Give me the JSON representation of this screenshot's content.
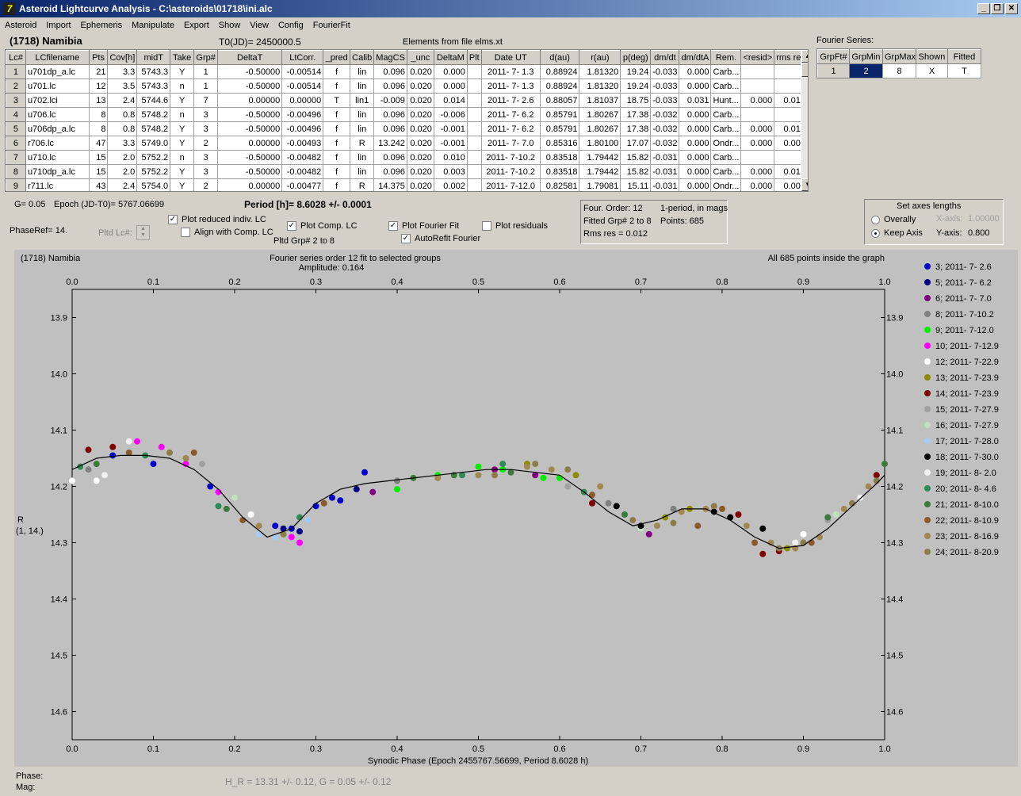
{
  "window": {
    "title": "Asteroid Lightcurve Analysis - C:\\asteroids\\01718\\ini.alc",
    "icon": "app-icon"
  },
  "menu": [
    "Asteroid",
    "Import",
    "Ephemeris",
    "Manipulate",
    "Export",
    "Show",
    "View",
    "Config",
    "FourierFit"
  ],
  "header": {
    "object": "(1718) Namibia",
    "t0": "T0(JD)= 2450000.5",
    "elements": "Elements from file elms.xt",
    "fourier_label": "Fourier Series:"
  },
  "lc_table": {
    "columns": [
      "Lc#",
      "LCfilename",
      "Pts",
      "Cov[h]",
      "midT",
      "Take",
      "Grp#",
      "DeltaT",
      "LtCorr.",
      "_pred",
      "Calib",
      "MagCS",
      "_unc",
      "DeltaM",
      "Plt",
      "Date UT",
      "d(au)",
      "r(au)",
      "p(deg)",
      "dm/dt",
      "dm/dtA",
      "Rem.",
      "<resid>",
      "rms res"
    ],
    "rows": [
      [
        "1",
        "u701dp_a.lc",
        "21",
        "3.3",
        "5743.3",
        "Y",
        "1",
        "-0.50000",
        "-0.00514",
        "f",
        "lin",
        "0.096",
        "0.020",
        "0.000",
        "",
        "2011- 7- 1.3",
        "0.88924",
        "1.81320",
        "19.24",
        "-0.033",
        "0.000",
        "Carb...",
        "",
        ""
      ],
      [
        "2",
        "u701.lc",
        "12",
        "3.5",
        "5743.3",
        "n",
        "1",
        "-0.50000",
        "-0.00514",
        "f",
        "lin",
        "0.096",
        "0.020",
        "0.000",
        "",
        "2011- 7- 1.3",
        "0.88924",
        "1.81320",
        "19.24",
        "-0.033",
        "0.000",
        "Carb...",
        "",
        ""
      ],
      [
        "3",
        "u702.lci",
        "13",
        "2.4",
        "5744.6",
        "Y",
        "7",
        "0.00000",
        "0.00000",
        "T",
        "lin1",
        "-0.009",
        "0.020",
        "0.014",
        "",
        "2011- 7- 2.6",
        "0.88057",
        "1.81037",
        "18.75",
        "-0.033",
        "0.031",
        "Hunt...",
        "0.000",
        "0.010"
      ],
      [
        "4",
        "u706.lc",
        "8",
        "0.8",
        "5748.2",
        "n",
        "3",
        "-0.50000",
        "-0.00496",
        "f",
        "lin",
        "0.096",
        "0.020",
        "-0.006",
        "",
        "2011- 7- 6.2",
        "0.85791",
        "1.80267",
        "17.38",
        "-0.032",
        "0.000",
        "Carb...",
        "",
        ""
      ],
      [
        "5",
        "u706dp_a.lc",
        "8",
        "0.8",
        "5748.2",
        "Y",
        "3",
        "-0.50000",
        "-0.00496",
        "f",
        "lin",
        "0.096",
        "0.020",
        "-0.001",
        "",
        "2011- 7- 6.2",
        "0.85791",
        "1.80267",
        "17.38",
        "-0.032",
        "0.000",
        "Carb...",
        "0.000",
        "0.018"
      ],
      [
        "6",
        "r706.lc",
        "47",
        "3.3",
        "5749.0",
        "Y",
        "2",
        "0.00000",
        "-0.00493",
        "f",
        "R",
        "13.242",
        "0.020",
        "-0.001",
        "",
        "2011- 7- 7.0",
        "0.85316",
        "1.80100",
        "17.07",
        "-0.032",
        "0.000",
        "Ondr...",
        "0.000",
        "0.006"
      ],
      [
        "7",
        "u710.lc",
        "15",
        "2.0",
        "5752.2",
        "n",
        "3",
        "-0.50000",
        "-0.00482",
        "f",
        "lin",
        "0.096",
        "0.020",
        "0.010",
        "",
        "2011- 7-10.2",
        "0.83518",
        "1.79442",
        "15.82",
        "-0.031",
        "0.000",
        "Carb...",
        "",
        ""
      ],
      [
        "8",
        "u710dp_a.lc",
        "15",
        "2.0",
        "5752.2",
        "Y",
        "3",
        "-0.50000",
        "-0.00482",
        "f",
        "lin",
        "0.096",
        "0.020",
        "0.003",
        "",
        "2011- 7-10.2",
        "0.83518",
        "1.79442",
        "15.82",
        "-0.031",
        "0.000",
        "Carb...",
        "0.000",
        "0.014"
      ],
      [
        "9",
        "r711.lc",
        "43",
        "2.4",
        "5754.0",
        "Y",
        "2",
        "0.00000",
        "-0.00477",
        "f",
        "R",
        "14.375",
        "0.020",
        "0.002",
        "",
        "2011- 7-12.0",
        "0.82581",
        "1.79081",
        "15.11",
        "-0.031",
        "0.000",
        "Ondr...",
        "0.000",
        "0.008"
      ]
    ]
  },
  "fourier_table": {
    "columns": [
      "GrpFt#",
      "GrpMin",
      "GrpMax",
      "Shown",
      "Fitted"
    ],
    "row": [
      "1",
      "2",
      "8",
      "X",
      "T"
    ]
  },
  "controls": {
    "g_value": "G= 0.05",
    "epoch": "Epoch (JD-T0)= 5767.06699",
    "period": "Period [h]= 8.6028 +/- 0.0001",
    "phaseref": "PhaseRef= 14.",
    "pltd_lc": "Pltd Lc#:",
    "plot_reduced": "Plot reduced indiv. LC",
    "align_comp": "Align with Comp. LC",
    "plot_comp": "Plot Comp. LC",
    "pltd_grp": "Pltd Grp#  2   to   8",
    "plot_fourier": "Plot Fourier Fit",
    "autorefit": "AutoRefit Fourier",
    "plot_resid": "Plot residuals",
    "four_order": "Four. Order: 12",
    "one_period": "1-period, in mags",
    "fitted_grp": "Fitted Grp# 2 to 8",
    "points": "Points: 685",
    "rms_res": "Rms res     = 0.012",
    "axes_title": "Set axes lengths",
    "overally": "Overally",
    "keep_axis": "Keep Axis",
    "xaxis_label": "X-axis:",
    "xaxis_val": "1.00000",
    "yaxis_label": "Y-axis:",
    "yaxis_val": "0.800"
  },
  "status": {
    "phase": "Phase:",
    "mag": "Mag:",
    "hr": "H_R = 13.31 +/- 0.12, G = 0.05 +/- 0.12"
  },
  "chart_data": {
    "type": "scatter",
    "title": "Fourier series order 12 fit to selected groups",
    "subtitle": "Amplitude: 0.164",
    "corner_left": "(1718) Namibia",
    "corner_right": "All 685 points inside the graph",
    "xlabel": "Synodic Phase (Epoch 2455767.56699, Period 8.6028 h)",
    "ylabel": "R",
    "ylabel2": "(1, 14.)",
    "xlim": [
      0,
      1
    ],
    "ylim": [
      14.65,
      13.85
    ],
    "xticks": [
      "0.0",
      "0.1",
      "0.2",
      "0.3",
      "0.4",
      "0.5",
      "0.6",
      "0.7",
      "0.8",
      "0.9",
      "1.0"
    ],
    "yticks": [
      "13.9",
      "14.0",
      "14.1",
      "14.2",
      "14.3",
      "14.4",
      "14.5",
      "14.6"
    ],
    "fit": {
      "x": [
        0,
        0.03,
        0.06,
        0.09,
        0.12,
        0.15,
        0.18,
        0.21,
        0.24,
        0.27,
        0.3,
        0.33,
        0.36,
        0.39,
        0.42,
        0.45,
        0.48,
        0.51,
        0.54,
        0.57,
        0.6,
        0.63,
        0.66,
        0.69,
        0.72,
        0.75,
        0.78,
        0.81,
        0.84,
        0.87,
        0.9,
        0.93,
        0.96,
        0.99,
        1.0
      ],
      "y": [
        14.17,
        14.15,
        14.145,
        14.145,
        14.15,
        14.17,
        14.205,
        14.255,
        14.29,
        14.275,
        14.23,
        14.205,
        14.195,
        14.19,
        14.185,
        14.18,
        14.175,
        14.17,
        14.17,
        14.175,
        14.18,
        14.21,
        14.245,
        14.27,
        14.26,
        14.24,
        14.24,
        14.26,
        14.29,
        14.31,
        14.305,
        14.275,
        14.235,
        14.195,
        14.18
      ]
    },
    "series": [
      {
        "name": "3; 2011- 7- 2.6",
        "color": "#0000cc",
        "x": [
          0.05,
          0.17,
          0.25,
          0.27,
          0.3,
          0.32,
          0.33,
          0.36,
          0.1
        ],
        "y": [
          14.145,
          14.2,
          14.27,
          14.275,
          14.235,
          14.22,
          14.225,
          14.175,
          14.16
        ]
      },
      {
        "name": "5; 2011- 7- 6.2",
        "color": "#000080",
        "x": [
          0.26,
          0.28,
          0.35
        ],
        "y": [
          14.275,
          14.28,
          14.205
        ]
      },
      {
        "name": "6; 2011- 7- 7.0",
        "color": "#800080",
        "x": [
          0.37,
          0.52,
          0.57,
          0.71
        ],
        "y": [
          14.21,
          14.17,
          14.18,
          14.285
        ]
      },
      {
        "name": "8; 2011- 7-10.2",
        "color": "#808080",
        "x": [
          0.02,
          0.4,
          0.66,
          0.74
        ],
        "y": [
          14.17,
          14.19,
          14.23,
          14.24
        ]
      },
      {
        "name": "9; 2011- 7-12.0",
        "color": "#00ee00",
        "x": [
          0.4,
          0.45,
          0.5,
          0.53,
          0.58,
          0.6
        ],
        "y": [
          14.205,
          14.18,
          14.165,
          14.17,
          14.185,
          14.185
        ]
      },
      {
        "name": "10; 2011- 7-12.9",
        "color": "#ff00ff",
        "x": [
          0.08,
          0.11,
          0.14,
          0.27,
          0.28,
          0.18
        ],
        "y": [
          14.12,
          14.13,
          14.16,
          14.29,
          14.3,
          14.21
        ]
      },
      {
        "name": "12; 2011- 7-22.9",
        "color": "#ffffff",
        "x": [
          0.0,
          0.03,
          0.22,
          0.86,
          0.9,
          0.95,
          0.98
        ],
        "y": [
          14.19,
          14.19,
          14.25,
          14.3,
          14.285,
          14.24,
          14.2
        ]
      },
      {
        "name": "13; 2011- 7-23.9",
        "color": "#8b8b00",
        "x": [
          0.56,
          0.62,
          0.73,
          0.76,
          0.88
        ],
        "y": [
          14.16,
          14.18,
          14.255,
          14.24,
          14.31
        ]
      },
      {
        "name": "14; 2011- 7-23.9",
        "color": "#800000",
        "x": [
          0.02,
          0.05,
          0.64,
          0.82,
          0.85,
          0.87,
          0.99
        ],
        "y": [
          14.135,
          14.13,
          14.23,
          14.25,
          14.32,
          14.315,
          14.18
        ]
      },
      {
        "name": "15; 2011- 7-27.9",
        "color": "#a0a0a0",
        "x": [
          0.16,
          0.61,
          0.93
        ],
        "y": [
          14.16,
          14.2,
          14.26
        ]
      },
      {
        "name": "16; 2011- 7-27.9",
        "color": "#c0e0c0",
        "x": [
          0.2,
          0.7,
          0.94
        ],
        "y": [
          14.22,
          14.275,
          14.25
        ]
      },
      {
        "name": "17; 2011- 7-28.0",
        "color": "#a6caf0",
        "x": [
          0.23,
          0.25,
          0.29
        ],
        "y": [
          14.285,
          14.29,
          14.26
        ]
      },
      {
        "name": "18; 2011- 7-30.0",
        "color": "#000000",
        "x": [
          0.67,
          0.7,
          0.79,
          0.81,
          0.85
        ],
        "y": [
          14.235,
          14.27,
          14.245,
          14.255,
          14.275
        ]
      },
      {
        "name": "19; 2011- 8- 2.0",
        "color": "#f0f0f0",
        "x": [
          0.04,
          0.07,
          0.89,
          0.97
        ],
        "y": [
          14.18,
          14.12,
          14.3,
          14.22
        ]
      },
      {
        "name": "20; 2011- 8- 4.6",
        "color": "#2e8b57",
        "x": [
          0.01,
          0.09,
          0.18,
          0.28,
          0.48,
          0.53,
          0.63
        ],
        "y": [
          14.165,
          14.145,
          14.235,
          14.255,
          14.18,
          14.16,
          14.21
        ]
      },
      {
        "name": "21; 2011- 8-10.0",
        "color": "#3c7a3c",
        "x": [
          0.03,
          0.19,
          0.42,
          0.47,
          0.54,
          0.68,
          0.93,
          1.0
        ],
        "y": [
          14.16,
          14.24,
          14.185,
          14.18,
          14.175,
          14.25,
          14.255,
          14.16
        ]
      },
      {
        "name": "22; 2011- 8-10.9",
        "color": "#8b5a2b",
        "x": [
          0.07,
          0.15,
          0.21,
          0.31,
          0.64,
          0.77,
          0.8,
          0.84,
          0.91
        ],
        "y": [
          14.14,
          14.14,
          14.26,
          14.23,
          14.215,
          14.27,
          14.24,
          14.3,
          14.3
        ]
      },
      {
        "name": "23; 2011- 8-16.9",
        "color": "#a08850",
        "x": [
          0.14,
          0.23,
          0.45,
          0.5,
          0.56,
          0.59,
          0.65,
          0.72,
          0.75,
          0.78,
          0.83,
          0.86,
          0.89,
          0.92,
          0.95,
          0.98
        ],
        "y": [
          14.15,
          14.27,
          14.185,
          14.18,
          14.165,
          14.17,
          14.2,
          14.27,
          14.245,
          14.24,
          14.27,
          14.3,
          14.31,
          14.29,
          14.24,
          14.2
        ]
      },
      {
        "name": "24; 2011- 8-20.9",
        "color": "#8b7d4a",
        "x": [
          0.12,
          0.26,
          0.52,
          0.57,
          0.61,
          0.69,
          0.74,
          0.79,
          0.87,
          0.9,
          0.96,
          0.99
        ],
        "y": [
          14.14,
          14.285,
          14.18,
          14.16,
          14.17,
          14.26,
          14.265,
          14.235,
          14.31,
          14.3,
          14.23,
          14.19
        ]
      }
    ]
  }
}
